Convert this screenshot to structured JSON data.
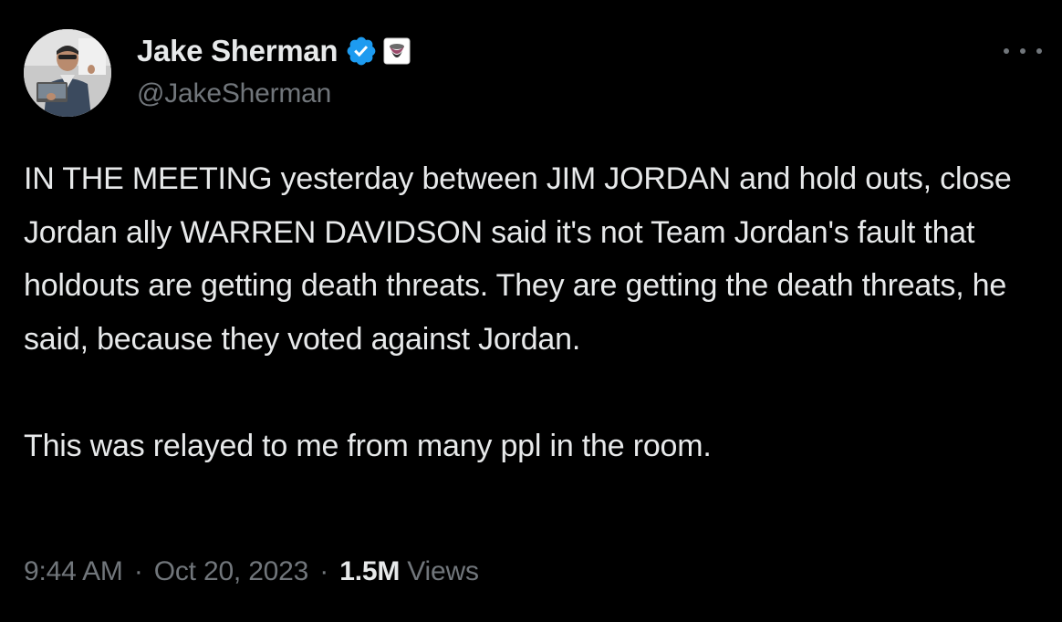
{
  "author": {
    "display_name": "Jake Sherman",
    "handle": "@JakeSherman",
    "verified_badge": "verified-check-icon",
    "affiliate_badge": "affiliate-logo-icon"
  },
  "tweet": {
    "paragraphs": [
      "IN THE MEETING yesterday between JIM JORDAN and hold outs, close Jordan ally WARREN DAVIDSON said it's not Team Jordan's fault that holdouts are getting death threats. They are getting the death threats, he said, because they voted against Jordan.",
      "This was relayed to me from many ppl in the room."
    ]
  },
  "meta": {
    "time": "9:44 AM",
    "separator": "·",
    "date": "Oct 20, 2023",
    "views_count": "1.5M",
    "views_label": "Views"
  },
  "colors": {
    "background": "#000000",
    "text": "#e7e9ea",
    "secondary": "#71767b",
    "verified_blue": "#1d9bf0"
  }
}
